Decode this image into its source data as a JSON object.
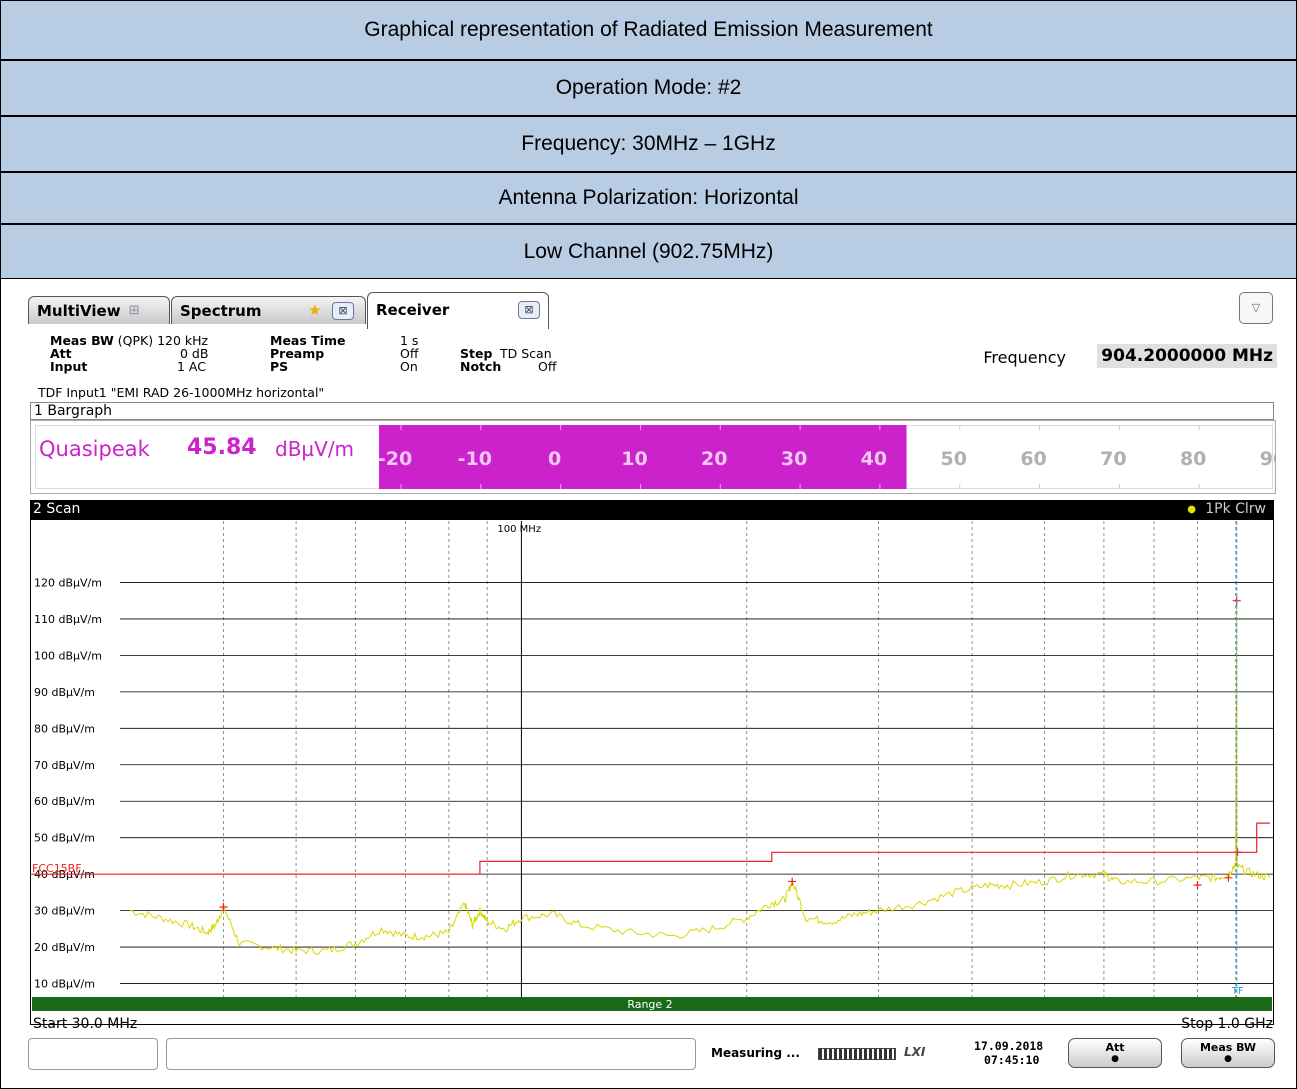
{
  "header": {
    "title": "Graphical representation of Radiated Emission Measurement",
    "mode": "Operation Mode: #2",
    "frequency": "Frequency: 30MHz – 1GHz",
    "polarization": "Antenna Polarization: Horizontal",
    "channel": "Low Channel (902.75MHz)"
  },
  "tabs": {
    "multiview": "MultiView",
    "spectrum": "Spectrum",
    "receiver": "Receiver"
  },
  "settings": {
    "meas_bw_label": "Meas BW",
    "meas_bw_mode": "(QPK)",
    "meas_bw_value": "120 kHz",
    "att_label": "Att",
    "att_value": "0 dB",
    "input_label": "Input",
    "input_value": "1 AC",
    "meas_time_label": "Meas Time",
    "meas_time_value": "1 s",
    "preamp_label": "Preamp",
    "preamp_value": "Off",
    "ps_label": "PS",
    "ps_value": "On",
    "step_label": "Step",
    "step_value": "TD Scan",
    "notch_label": "Notch",
    "notch_value": "Off",
    "tdf": "TDF Input1 \"EMI RAD 26-1000MHz horizontal\"",
    "frequency_label": "Frequency",
    "frequency_value": "904.2000000 MHz"
  },
  "bargraph": {
    "title": "1 Bargraph",
    "detector": "Quasipeak",
    "value": "45.84",
    "unit": "dBµV/m",
    "fill_value": 45.84,
    "scale_min": -20,
    "scale_max": 90,
    "ticks": [
      "-20",
      "-10",
      "0",
      "10",
      "20",
      "30",
      "40",
      "50",
      "60",
      "70",
      "80",
      "90"
    ],
    "fill_color": "#cc22cc"
  },
  "scan": {
    "title": "2 Scan",
    "trace_label": "1Pk Clrw",
    "marker_100": "100 MHz",
    "limit_label": "FCC15BF",
    "range_label": "Range 2",
    "start": "Start 30.0 MHz",
    "stop": "Stop 1.0 GHz",
    "tf": "TF"
  },
  "chart_data": {
    "type": "line",
    "title": "2 Scan",
    "xscale": "log",
    "xlim": [
      30,
      1000
    ],
    "ylim": [
      0,
      130
    ],
    "y_tick_labels": [
      "120 dBµV/m",
      "110 dBµV/m",
      "100 dBµV/m",
      "90 dBµV/m",
      "80 dBµV/m",
      "70 dBµV/m",
      "60 dBµV/m",
      "50 dBµV/m",
      "40 dBµV/m",
      "30 dBµV/m",
      "20 dBµV/m",
      "10 dBµV/m"
    ],
    "y_ticks": [
      120,
      110,
      100,
      90,
      80,
      70,
      60,
      50,
      40,
      30,
      20,
      10
    ],
    "grid": true,
    "series": [
      {
        "name": "1Pk Clrw",
        "color": "#d8d800",
        "x": [
          30,
          33,
          36,
          38,
          39,
          40,
          42,
          46,
          50,
          55,
          60,
          65,
          70,
          75,
          80,
          84,
          86,
          88,
          90,
          95,
          100,
          110,
          120,
          140,
          160,
          180,
          200,
          215,
          225,
          230,
          240,
          260,
          280,
          300,
          340,
          380,
          420,
          450,
          500,
          550,
          600,
          620,
          700,
          800,
          850,
          880,
          900,
          902.75,
          903,
          905,
          950,
          1000
        ],
        "y": [
          30,
          28,
          26,
          24,
          26,
          31,
          21,
          20,
          19,
          19,
          21,
          25,
          23,
          23,
          24,
          32,
          26,
          30,
          27,
          25,
          28,
          29,
          26,
          24,
          23,
          25,
          28,
          32,
          33,
          38,
          28,
          27,
          29,
          30,
          32,
          35,
          37,
          37,
          38,
          40,
          40,
          38,
          38,
          39,
          39,
          40,
          43,
          115,
          45,
          42,
          40,
          39
        ]
      },
      {
        "name": "FCC15BF",
        "color": "#ee2222",
        "x": [
          30,
          88,
          88,
          216,
          216,
          960,
          960,
          1000
        ],
        "y": [
          40,
          40,
          43.5,
          43.5,
          46,
          46,
          54,
          54
        ]
      }
    ],
    "markers": [
      {
        "x": 40,
        "y": 31
      },
      {
        "x": 230,
        "y": 38
      },
      {
        "x": 800,
        "y": 37
      },
      {
        "x": 880,
        "y": 39
      },
      {
        "x": 902.75,
        "y": 115
      },
      {
        "x": 905,
        "y": 46
      }
    ]
  },
  "status": {
    "measuring": "Measuring ...",
    "date": "17.09.2018",
    "time": "07:45:10",
    "att_btn": "Att",
    "measbw_btn": "Meas BW",
    "lxi": "LXI"
  }
}
